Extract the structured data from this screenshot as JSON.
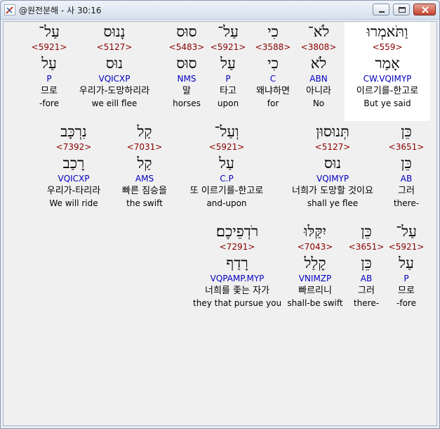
{
  "window": {
    "title": "@원전분해 - 사 30:16",
    "buttons": {
      "minimize": "minimize",
      "maximize": "maximize",
      "close": "close"
    }
  },
  "rows": [
    [
      {
        "heb": "וַתֹּאמְרוּ",
        "num": "<559>",
        "lemma": "אָמַר",
        "code": "CW.VQIMYP",
        "ko": "이르기를-한고로",
        "en": "But ye said"
      },
      {
        "heb": "לֹא־",
        "num": "<3808>",
        "lemma": "לֹא",
        "code": "ABN",
        "ko": "아니라",
        "en": "No"
      },
      {
        "heb": "כִי",
        "num": "<3588>",
        "lemma": "כִי",
        "code": "C",
        "ko": "왜냐하면",
        "en": "for"
      },
      {
        "heb": "עַל־",
        "num": "<5921>",
        "lemma": "עַל",
        "code": "P",
        "ko": "타고",
        "en": "upon"
      },
      {
        "heb": "סוּס",
        "num": "<5483>",
        "lemma": "סוּס",
        "code": "NMS",
        "ko": "말",
        "en": "horses"
      },
      {
        "heb": "נָנוּס",
        "num": "<5127>",
        "lemma": "נוּס",
        "code": "VQICXP",
        "ko": "우리가-도망하리라",
        "en": "we eill flee"
      },
      {
        "heb": "עַל־",
        "num": "<5921>",
        "lemma": "עַל",
        "code": "P",
        "ko": "므로",
        "en": "-fore"
      }
    ],
    [
      {
        "heb": "כֵּן",
        "num": "<3651>",
        "lemma": "כֵּן",
        "code": "AB",
        "ko": "그러",
        "en": "there-"
      },
      {
        "heb": "תְּנוּסוּן",
        "num": "<5127>",
        "lemma": "נוּס",
        "code": "VQIMYP",
        "ko": "너희가 도망할 것이요",
        "en": "shall ye flee"
      },
      {
        "heb": "וְעַל־",
        "num": "<5921>",
        "lemma": "עַל",
        "code": "C.P",
        "ko": "또 이르기를-한고로",
        "en": "and-upon"
      },
      {
        "heb": "קַל",
        "num": "<7031>",
        "lemma": "קַל",
        "code": "AMS",
        "ko": "빠른 짐승을",
        "en": "the swift"
      },
      {
        "heb": "נִרְכָּב",
        "num": "<7392>",
        "lemma": "רָכַב",
        "code": "VQICXP",
        "ko": "우리가-타리라",
        "en": "We will ride"
      }
    ],
    [
      {
        "heb": "עַל־",
        "num": "<5921>",
        "lemma": "עַל",
        "code": "P",
        "ko": "므로",
        "en": "-fore"
      },
      {
        "heb": "כֵּן",
        "num": "<3651>",
        "lemma": "כֵּן",
        "code": "AB",
        "ko": "그러",
        "en": "there-"
      },
      {
        "heb": "יִקַּלּוּ",
        "num": "<7043>",
        "lemma": "קָלַל",
        "code": "VNIMZP",
        "ko": "빠르리니",
        "en": "shall-be swift"
      },
      {
        "heb": "רֹדְפֵיכֶם׃",
        "num": "<7291>",
        "lemma": "רָדַף",
        "code": "VQPAMP.MYP",
        "ko": "너희를 좇는 자가",
        "en": "they that pursue you"
      }
    ]
  ]
}
